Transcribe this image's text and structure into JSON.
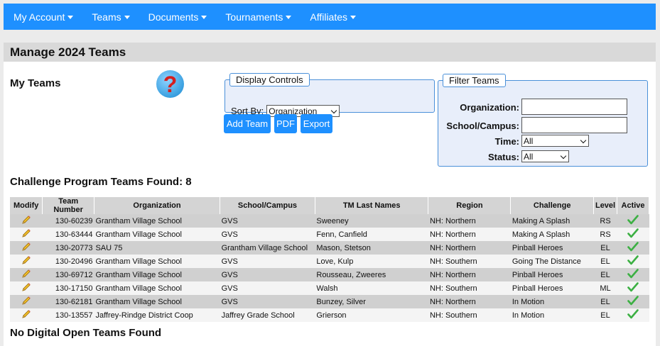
{
  "nav": [
    {
      "label": "My Account"
    },
    {
      "label": "Teams"
    },
    {
      "label": "Documents"
    },
    {
      "label": "Tournaments"
    },
    {
      "label": "Affiliates"
    }
  ],
  "page": {
    "title": "Manage 2024 Teams",
    "my_teams": "My Teams",
    "help_glyph": "?"
  },
  "display_controls": {
    "legend": "Display Controls",
    "sort_label": "Sort By:",
    "sort_value": "Organization"
  },
  "buttons": {
    "add_team": "Add Team",
    "pdf": "PDF",
    "export": "Export"
  },
  "filter": {
    "legend": "Filter Teams",
    "org_label": "Organization:",
    "org_value": "",
    "school_label": "School/Campus:",
    "school_value": "",
    "time_label": "Time:",
    "time_value": "All",
    "status_label": "Status:",
    "status_value": "All"
  },
  "challenge_heading": "Challenge Program Teams Found: 8",
  "digital_heading": "No Digital Open Teams Found",
  "table": {
    "headers": [
      "Modify",
      "Team Number",
      "Organization",
      "School/Campus",
      "TM Last Names",
      "Region",
      "Challenge",
      "Level",
      "Active"
    ],
    "rows": [
      {
        "team": "130-60239",
        "org": "Grantham Village School",
        "school": "GVS",
        "names": "Sweeney",
        "region": "NH: Northern",
        "challenge": "Making A Splash",
        "level": "RS"
      },
      {
        "team": "130-63444",
        "org": "Grantham Village School",
        "school": "GVS",
        "names": "Fenn, Canfield",
        "region": "NH: Northern",
        "challenge": "Making A Splash",
        "level": "RS"
      },
      {
        "team": "130-20773",
        "org": "SAU 75",
        "school": "Grantham Village School",
        "names": "Mason, Stetson",
        "region": "NH: Northern",
        "challenge": "Pinball Heroes",
        "level": "EL"
      },
      {
        "team": "130-20496",
        "org": "Grantham Village School",
        "school": "GVS",
        "names": "Love, Kulp",
        "region": "NH: Southern",
        "challenge": "Going The Distance",
        "level": "EL"
      },
      {
        "team": "130-69712",
        "org": "Grantham Village School",
        "school": "GVS",
        "names": "Rousseau, Zweeres",
        "region": "NH: Northern",
        "challenge": "Pinball Heroes",
        "level": "EL"
      },
      {
        "team": "130-17150",
        "org": "Grantham Village School",
        "school": "GVS",
        "names": "Walsh",
        "region": "NH: Southern",
        "challenge": "Pinball Heroes",
        "level": "ML"
      },
      {
        "team": "130-62181",
        "org": "Grantham Village School",
        "school": "GVS",
        "names": "Bunzey, Silver",
        "region": "NH: Northern",
        "challenge": "In Motion",
        "level": "EL"
      },
      {
        "team": "130-13557",
        "org": "Jaffrey-Rindge District Coop",
        "school": "Jaffrey Grade School",
        "names": "Grierson",
        "region": "NH: Southern",
        "challenge": "In Motion",
        "level": "EL"
      }
    ]
  },
  "colors": {
    "nav": "#1e90ff",
    "button": "#1e90ff",
    "fieldset_border": "#4a90d9",
    "help_mark": "#d41f1f",
    "check": "#3cb043"
  },
  "icons": {
    "modify": "pencil-icon",
    "active": "check-icon",
    "help": "help-icon"
  }
}
